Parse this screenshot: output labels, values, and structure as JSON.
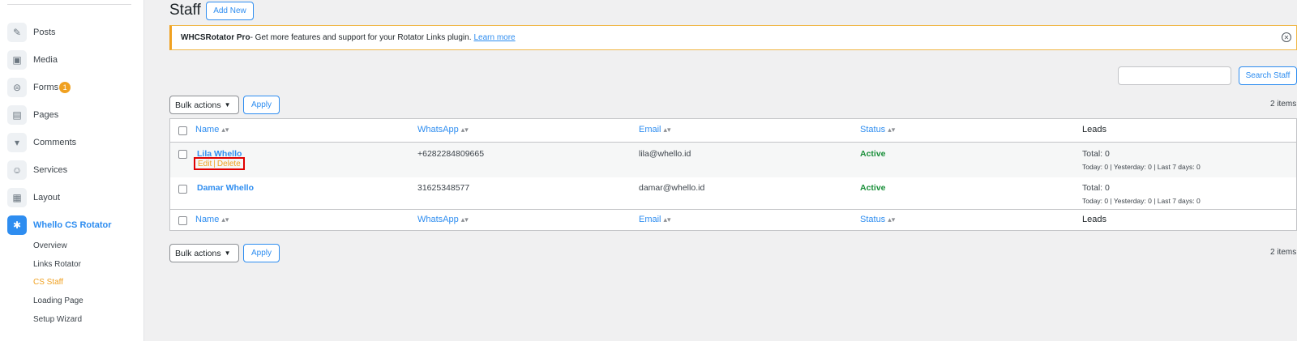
{
  "sidebar": {
    "items": [
      {
        "label": "Posts",
        "icon": "pin-icon"
      },
      {
        "label": "Media",
        "icon": "media-icon"
      },
      {
        "label": "Forms",
        "icon": "forms-icon",
        "badge": "1"
      },
      {
        "label": "Pages",
        "icon": "pages-icon"
      },
      {
        "label": "Comments",
        "icon": "comment-icon"
      },
      {
        "label": "Services",
        "icon": "smile-icon"
      },
      {
        "label": "Layout",
        "icon": "layout-icon"
      },
      {
        "label": "Whello CS Rotator",
        "icon": "gear-icon"
      }
    ],
    "submenu": [
      "Overview",
      "Links Rotator",
      "CS Staff",
      "Loading Page",
      "Setup Wizard"
    ]
  },
  "page": {
    "title": "Staff",
    "add_new": "Add New"
  },
  "notice": {
    "brand": "WHCSRotator Pro",
    "text": " - Get more features and support for your Rotator Links plugin.",
    "link": "Learn more"
  },
  "search": {
    "button": "Search Staff",
    "value": ""
  },
  "bulk": {
    "label": "Bulk actions",
    "apply": "Apply",
    "items_count": "2 items"
  },
  "table": {
    "columns": [
      "Name",
      "WhatsApp",
      "Email",
      "Status",
      "Leads"
    ],
    "rows": [
      {
        "name": "Lila Whello",
        "whatsapp": "+6282284809665",
        "email": "lila@whello.id",
        "status": "Active",
        "leads_total": "Total: 0",
        "leads_detail": "Today: 0 | Yesterday: 0 | Last 7 days: 0",
        "actions": [
          "Edit",
          "Delete"
        ]
      },
      {
        "name": "Damar Whello",
        "whatsapp": "31625348577",
        "email": "damar@whello.id",
        "status": "Active",
        "leads_total": "Total: 0",
        "leads_detail": "Today: 0 | Yesterday: 0 | Last 7 days: 0"
      }
    ]
  },
  "colors": {
    "accent": "#2e8df0",
    "orange": "#f0a121",
    "active": "#1a8f3a",
    "highlight": "#e00000"
  }
}
